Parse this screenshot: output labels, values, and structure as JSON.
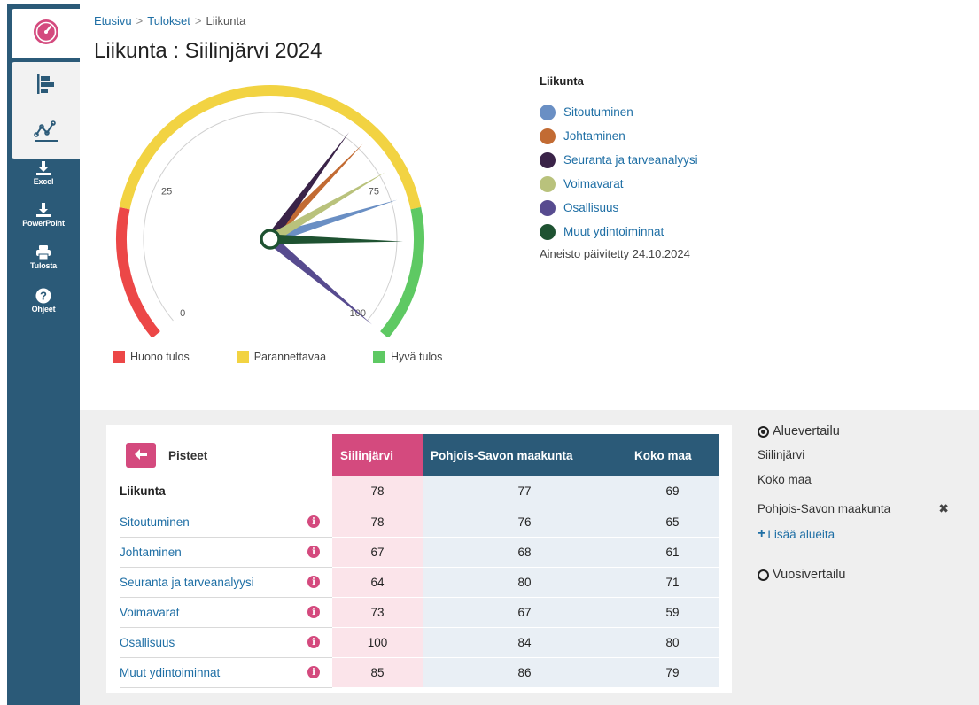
{
  "sidebar": {
    "actions": [
      {
        "label": "Excel",
        "icon": "download-icon"
      },
      {
        "label": "PowerPoint",
        "icon": "download-icon"
      },
      {
        "label": "Tulosta",
        "icon": "print-icon"
      },
      {
        "label": "Ohjeet",
        "icon": "help-icon"
      }
    ],
    "tabs": [
      {
        "icon": "gauge-icon",
        "active": true
      },
      {
        "icon": "bar-chart-icon",
        "active": false
      },
      {
        "icon": "trend-chart-icon",
        "active": false
      }
    ]
  },
  "breadcrumb": {
    "home": "Etusivu",
    "results": "Tulokset",
    "current": "Liikunta"
  },
  "page_title": "Liikunta : Siilinjärvi 2024",
  "legend": {
    "title": "Liikunta",
    "items": [
      {
        "label": "Sitoutuminen",
        "color": "#6a8fc4"
      },
      {
        "label": "Johtaminen",
        "color": "#c26b33"
      },
      {
        "label": "Seuranta ja tarveanalyysi",
        "color": "#3a2348"
      },
      {
        "label": "Voimavarat",
        "color": "#b9c27c"
      },
      {
        "label": "Osallisuus",
        "color": "#574b8f"
      },
      {
        "label": "Muut ydintoiminnat",
        "color": "#1e5231"
      }
    ],
    "updated": "Aineisto päivitetty 24.10.2024"
  },
  "zones": [
    {
      "label": "Huono tulos",
      "color": "#ec4747"
    },
    {
      "label": "Parannettavaa",
      "color": "#f2d342"
    },
    {
      "label": "Hyvä tulos",
      "color": "#5ec963"
    }
  ],
  "chart_data": {
    "type": "gauge",
    "range": [
      0,
      100
    ],
    "ticks": [
      "0",
      "25",
      "75",
      "100"
    ],
    "bands": [
      {
        "label": "Huono tulos",
        "from": 0,
        "to": 20,
        "color": "#ec4747"
      },
      {
        "label": "Parannettavaa",
        "from": 20,
        "to": 80,
        "color": "#f2d342"
      },
      {
        "label": "Hyvä tulos",
        "from": 80,
        "to": 100,
        "color": "#5ec963"
      }
    ],
    "needles": [
      {
        "label": "Sitoutuminen",
        "value": 78,
        "color": "#6a8fc4"
      },
      {
        "label": "Johtaminen",
        "value": 67,
        "color": "#c26b33"
      },
      {
        "label": "Seuranta ja tarveanalyysi",
        "value": 64,
        "color": "#3a2348"
      },
      {
        "label": "Voimavarat",
        "value": 73,
        "color": "#b9c27c"
      },
      {
        "label": "Osallisuus",
        "value": 100,
        "color": "#574b8f"
      },
      {
        "label": "Muut ydintoiminnat",
        "value": 85,
        "color": "#1e5231"
      }
    ]
  },
  "table": {
    "back_label": "Pisteet",
    "columns": [
      "Siilinjärvi",
      "Pohjois-Savon maakunta",
      "Koko maa"
    ],
    "rows": [
      {
        "label": "Liikunta",
        "values": [
          "78",
          "77",
          "69"
        ]
      },
      {
        "label": "Sitoutuminen",
        "values": [
          "78",
          "76",
          "65"
        ]
      },
      {
        "label": "Johtaminen",
        "values": [
          "67",
          "68",
          "61"
        ]
      },
      {
        "label": "Seuranta ja tarveanalyysi",
        "values": [
          "64",
          "80",
          "71"
        ]
      },
      {
        "label": "Voimavarat",
        "values": [
          "73",
          "67",
          "59"
        ]
      },
      {
        "label": "Osallisuus",
        "values": [
          "100",
          "84",
          "80"
        ]
      },
      {
        "label": "Muut ydintoiminnat",
        "values": [
          "85",
          "86",
          "79"
        ]
      }
    ]
  },
  "compare": {
    "region_heading": "Aluevertailu",
    "regions": [
      "Siilinjärvi",
      "Koko maa",
      "Pohjois-Savon maakunta"
    ],
    "add_label": "Lisää alueita",
    "year_heading": "Vuosivertailu"
  }
}
